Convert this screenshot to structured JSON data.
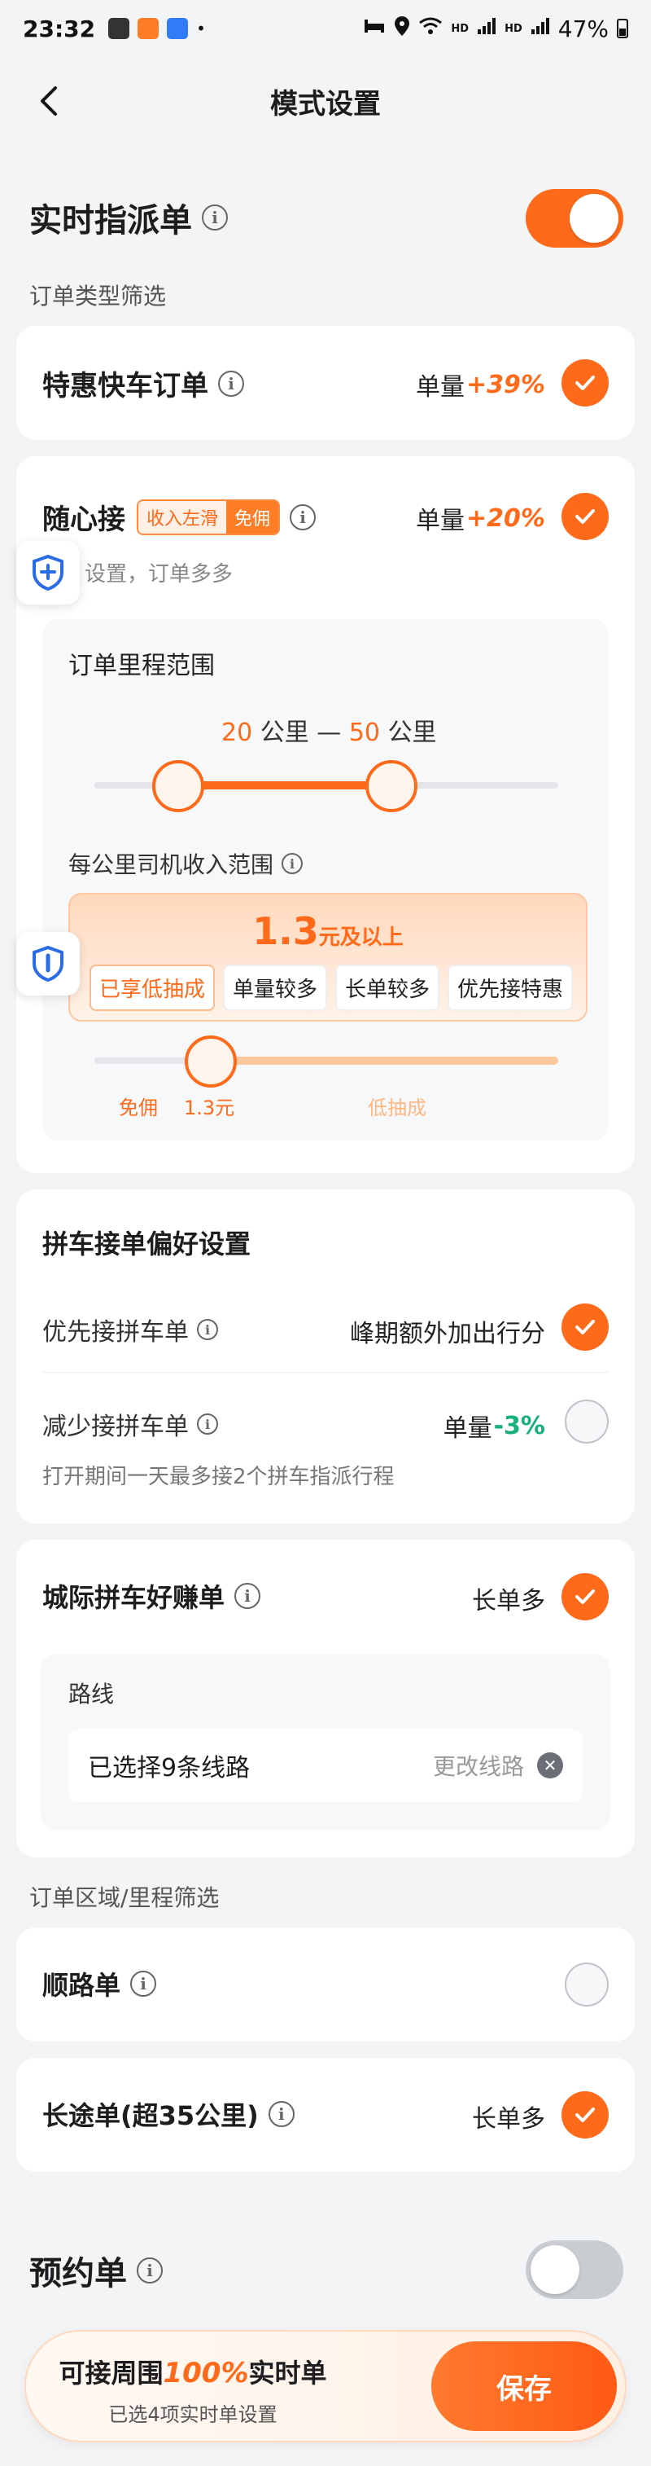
{
  "status_bar": {
    "time": "23:32",
    "battery": "47%",
    "signal1": "HD",
    "signal2": "HD"
  },
  "nav": {
    "title": "模式设置"
  },
  "realtime": {
    "title": "实时指派单",
    "enabled": true,
    "filter_label": "订单类型筛选"
  },
  "express": {
    "title": "特惠快车订单",
    "qty_label": "单量",
    "qty_pct": "+39%",
    "checked": true
  },
  "suixin": {
    "title": "随心接",
    "tag1": "收入左滑",
    "tag2": "免佣",
    "qty_label": "单量",
    "qty_pct": "+20%",
    "checked": true,
    "subtitle": "设置，订单多多",
    "mileage": {
      "label": "订单里程范围",
      "min": "20",
      "max": "50",
      "unit": "公里",
      "dash": "—",
      "min_fraction": 0.18,
      "max_fraction": 0.64
    },
    "income": {
      "label": "每公里司机收入范围",
      "value": "1.3",
      "unit": "元及以上",
      "chips": [
        "已享低抽成",
        "单量较多",
        "长单较多",
        "优先接特惠"
      ],
      "slider_left": "免佣",
      "slider_value": "1.3元",
      "slider_right": "低抽成",
      "value_fraction": 0.25
    }
  },
  "carpool": {
    "title": "拼车接单偏好设置",
    "prefer_label": "优先接拼车单",
    "prefer_right": "峰期额外加出行分",
    "prefer_checked": true,
    "reduce_label": "减少接拼车单",
    "reduce_qty_label": "单量",
    "reduce_qty_pct": "-3%",
    "reduce_checked": false,
    "reduce_note": "打开期间一天最多接2个拼车指派行程"
  },
  "intercity": {
    "title": "城际拼车好赚单",
    "right": "长单多",
    "checked": true,
    "route_label": "路线",
    "route_value": "已选择9条线路",
    "route_change": "更改线路"
  },
  "region_label": "订单区域/里程筛选",
  "shunlu": {
    "title": "顺路单",
    "checked": false
  },
  "longtrip": {
    "title": "长途单(超35公里)",
    "right": "长单多",
    "checked": true
  },
  "reserve": {
    "title": "预约单",
    "enabled": false
  },
  "bottom": {
    "prefix": "可接周围",
    "pct": "100%",
    "suffix": "实时单",
    "sub": "已选4项实时单设置",
    "save": "保存"
  },
  "colors": {
    "accent": "#ff6a1a",
    "green": "#16b07a"
  }
}
